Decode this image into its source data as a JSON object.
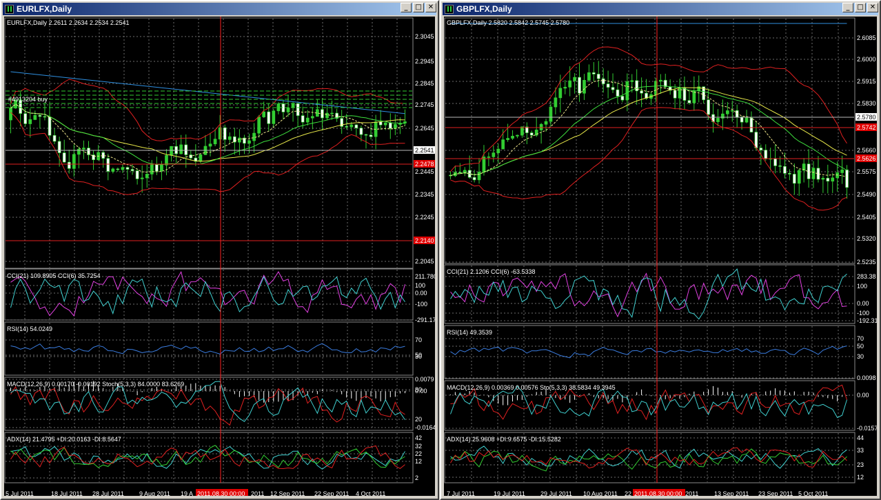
{
  "left": {
    "title": "EURLFX,Daily",
    "header": "EURLFX,Daily  2.2611 2.2634 2.2534 2.2541",
    "price_ticks": [
      "2.3045",
      "2.2945",
      "2.2845",
      "2.2745",
      "2.2645",
      "2.2445",
      "2.2345",
      "2.2245",
      "2.2045"
    ],
    "price_label": "2.2541",
    "red_labels": [
      "2.2478",
      "2.2140"
    ],
    "orders": [
      "#4913204 buy"
    ],
    "cci_header": "CCI(21) 109.8905  CCI(6) 35.7254",
    "cci_ticks": [
      "211.7801",
      "100",
      "0.00",
      "-100",
      "-291.174"
    ],
    "rsi_header": "RSI(14) 54.0249",
    "rsi_ticks": [
      "70",
      "50",
      "30"
    ],
    "macd_header": "MACD(12,26,9) 0.00170 -0.00192  Stoch(5,3,3) 84.0000 83.6269",
    "macd_ticks": [
      "0.0079",
      "80",
      "0.00",
      "20",
      "-0.01641"
    ],
    "adx_header": "ADX(14) 21.4795 +DI:20.0163 -DI:8.5647",
    "adx_ticks": [
      "42",
      "32",
      "22",
      "12",
      "2"
    ],
    "dates": [
      "5 Jul 2011",
      "18 Jul 2011",
      "28 Jul 2011",
      "9 Aug 2011",
      "19 A",
      "2011.08.30 00:00",
      "2011",
      "12 Sep 2011",
      "22 Sep 2011",
      "4 Oct 2011"
    ],
    "cursor_date": "2011.08.30 00:00"
  },
  "right": {
    "title": "GBPLFX,Daily",
    "header": "GBPLFX,Daily  2.5820 2.5842 2.5745 2.5780",
    "price_ticks": [
      "2.6085",
      "2.6000",
      "2.5915",
      "2.5830",
      "2.5660",
      "2.5575",
      "2.5490",
      "2.5405",
      "2.5320",
      "2.5235"
    ],
    "price_label": "2.5780",
    "red_labels": [
      "2.5742",
      "2.5626"
    ],
    "cci_header": "CCI(21) 2.1206  CCI(6) -63.5338",
    "cci_ticks": [
      "283.38",
      "100",
      "0.00",
      "-100",
      "-192.315"
    ],
    "rsi_header": "RSI(14) 49.3539",
    "rsi_ticks": [
      "70",
      "50",
      "30"
    ],
    "macd_header": "MACD(12,26,9) 0.00369 0.00576  Sto(5,3,3) 38.5834 49.3945",
    "macd_ticks": [
      "0.0098",
      "0.00",
      "-0.01573"
    ],
    "adx_header": "ADX(14) 25.9608 +DI:9.6575 -DI:15.5282",
    "adx_ticks": [
      "44",
      "33",
      "23",
      "12"
    ],
    "dates": [
      "7 Jul 2011",
      "19 Jul 2011",
      "29 Jul 2011",
      "10 Aug 2011",
      "22",
      "2011.08.30 00:00",
      "2011",
      "13 Sep 2011",
      "23 Sep 2011",
      "5 Oct 2011"
    ],
    "cursor_date": "2011.08.30 00:00"
  },
  "colors": {
    "bull": "#32cd32",
    "bear": "#ffffff",
    "ma_yellow": "#e8e84a",
    "ma_blue": "#2f8fe0",
    "ma_red": "#e02020",
    "grid": "#6e6e6e",
    "cursor": "#ff2020"
  }
}
